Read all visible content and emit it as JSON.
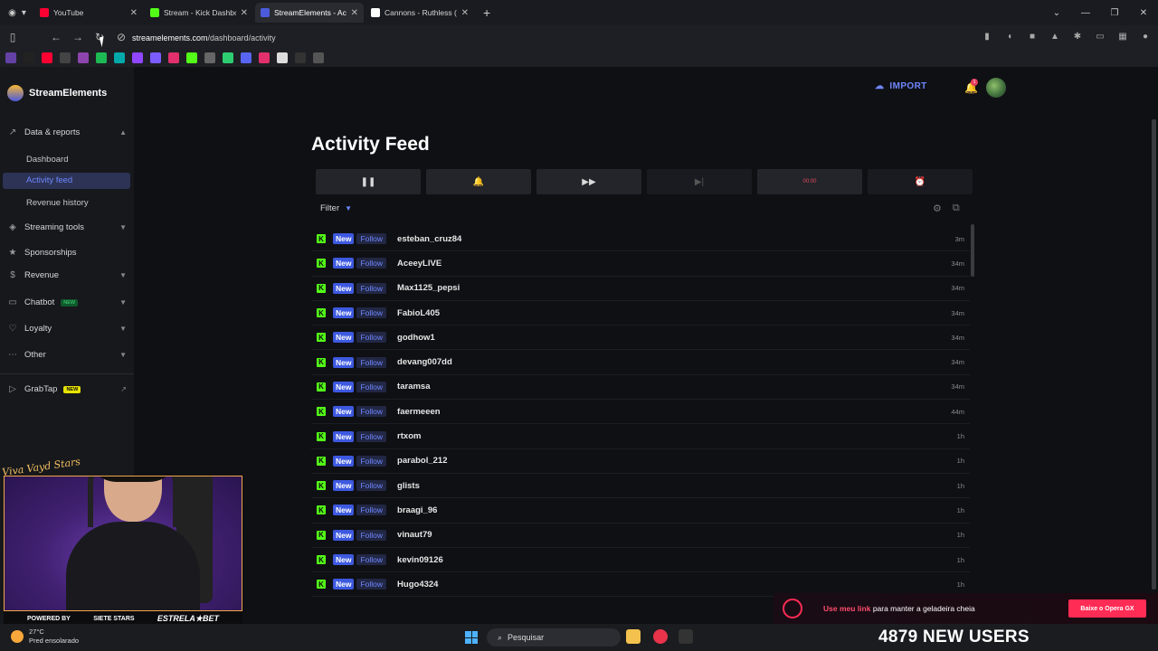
{
  "browser": {
    "tabs": [
      {
        "title": "YouTube",
        "color": "#ff0033"
      },
      {
        "title": "Stream - Kick Dashboa",
        "color": "#53fc18"
      },
      {
        "title": "StreamElements - Acti",
        "color": "#4b5bdc"
      },
      {
        "title": "Cannons - Ruthless (L",
        "color": "#ffffff"
      }
    ],
    "url_domain": "streamelements.com",
    "url_path": "/dashboard/activity"
  },
  "sidebar": {
    "brand": "StreamElements",
    "data_reports": "Data & reports",
    "dashboard": "Dashboard",
    "activity_feed": "Activity feed",
    "revenue_history": "Revenue history",
    "streaming_tools": "Streaming tools",
    "sponsorships": "Sponsorships",
    "revenue": "Revenue",
    "chatbot": "Chatbot",
    "chatbot_badge": "NEW",
    "loyalty": "Loyalty",
    "other": "Other",
    "grabtap": "GrabTap",
    "grabtap_badge": "NEW"
  },
  "header": {
    "import": "IMPORT",
    "notifications": "1"
  },
  "main": {
    "title": "Activity Feed",
    "timer": "00:00",
    "filter": "Filter"
  },
  "feed": [
    {
      "user": "esteban_cruz84",
      "time": "3m"
    },
    {
      "user": "AceeyLIVE",
      "time": "34m"
    },
    {
      "user": "Max1125_pepsi",
      "time": "34m"
    },
    {
      "user": "FabioL405",
      "time": "34m"
    },
    {
      "user": "godhow1",
      "time": "34m"
    },
    {
      "user": "devang007dd",
      "time": "34m"
    },
    {
      "user": "taramsa",
      "time": "34m"
    },
    {
      "user": "faermeeen",
      "time": "44m"
    },
    {
      "user": "rtxom",
      "time": "1h"
    },
    {
      "user": "parabol_212",
      "time": "1h"
    },
    {
      "user": "glists",
      "time": "1h"
    },
    {
      "user": "braagi_96",
      "time": "1h"
    },
    {
      "user": "vinaut79",
      "time": "1h"
    },
    {
      "user": "kevin09126",
      "time": "1h"
    },
    {
      "user": "Hugo4324",
      "time": "1h"
    }
  ],
  "feed_labels": {
    "new": "New",
    "follow": "Follow",
    "kick_glyph": "K"
  },
  "overlay": {
    "signature": "Viva Vayd Stars",
    "powered_by": "POWERED BY",
    "sponsor_left": "SIETE STARS",
    "sponsor_right": "ESTRELA★BET",
    "promo_highlight": "Use meu link",
    "promo_text": "para manter a geladeira cheia",
    "promo_cta": "Baixe o Opera GX",
    "users_count": "4879 NEW USERS"
  },
  "taskbar": {
    "temp": "27°C",
    "weather": "Pred ensolarado",
    "search": "Pesquisar"
  }
}
